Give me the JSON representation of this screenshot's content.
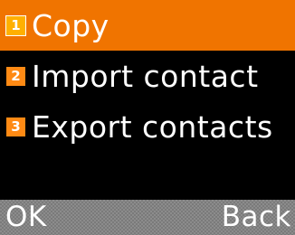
{
  "menu": {
    "items": [
      {
        "number": "1",
        "label": "Copy",
        "selected": true
      },
      {
        "number": "2",
        "label": "Import contact",
        "selected": false
      },
      {
        "number": "3",
        "label": "Export contacts",
        "selected": false
      }
    ]
  },
  "softkeys": {
    "left": "OK",
    "right": "Back"
  },
  "colors": {
    "selection": "#f07400",
    "badge": "#ff8a14",
    "background": "#000000"
  }
}
